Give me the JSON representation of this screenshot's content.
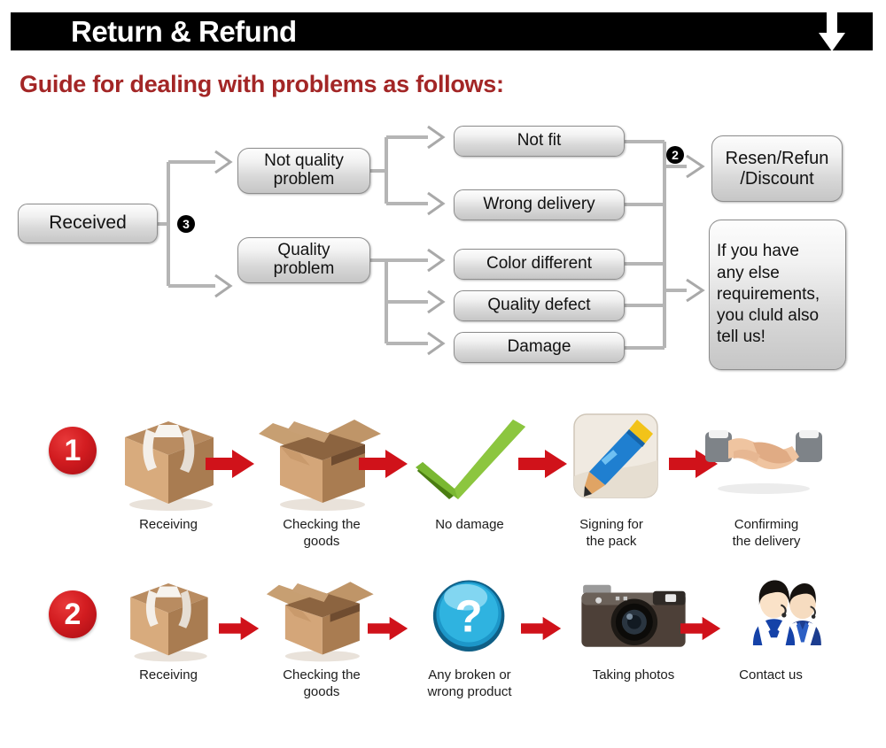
{
  "header": {
    "title": "Return & Refund",
    "arrow_icon": "down-arrow-icon"
  },
  "subtitle": "Guide for dealing with problems as follows:",
  "flowchart": {
    "nodes": {
      "received": "Received",
      "not_quality_problem": "Not quality\nproblem",
      "quality_problem": "Quality\nproblem",
      "not_fit": "Not fit",
      "wrong_delivery": "Wrong delivery",
      "color_different": "Color different",
      "quality_defect": "Quality defect",
      "damage": "Damage",
      "resend_refund_discount": "Resen/Refun\n/Discount",
      "note": "If you have\nany else\nrequirements,\nyou cluld also\ntell us!"
    },
    "markers": {
      "split_marker": "3",
      "merge_marker": "2"
    }
  },
  "steps": {
    "row1": {
      "number": "1",
      "items": [
        {
          "icon": "closed-box-icon",
          "label": "Receiving"
        },
        {
          "icon": "open-box-icon",
          "label": "Checking the\ngoods"
        },
        {
          "icon": "green-check-icon",
          "label": "No damage"
        },
        {
          "icon": "pencil-signing-icon",
          "label": "Signing for\nthe pack"
        },
        {
          "icon": "handshake-icon",
          "label": "Confirming\nthe delivery"
        }
      ]
    },
    "row2": {
      "number": "2",
      "items": [
        {
          "icon": "closed-box-icon",
          "label": "Receiving"
        },
        {
          "icon": "open-box-icon",
          "label": "Checking the\ngoods"
        },
        {
          "icon": "question-mark-icon",
          "label": "Any broken or\nwrong product"
        },
        {
          "icon": "camera-icon",
          "label": "Taking photos"
        },
        {
          "icon": "support-agents-icon",
          "label": "Contact us"
        }
      ]
    },
    "arrow_icon": "red-right-arrow-icon"
  },
  "colors": {
    "header_bg": "#000000",
    "header_text": "#ffffff",
    "subtitle": "#a32626",
    "arrow_red": "#d0121a",
    "number_red": "#c9151b",
    "node_border": "#8d8d8d",
    "connector": "#b5b5b5"
  }
}
